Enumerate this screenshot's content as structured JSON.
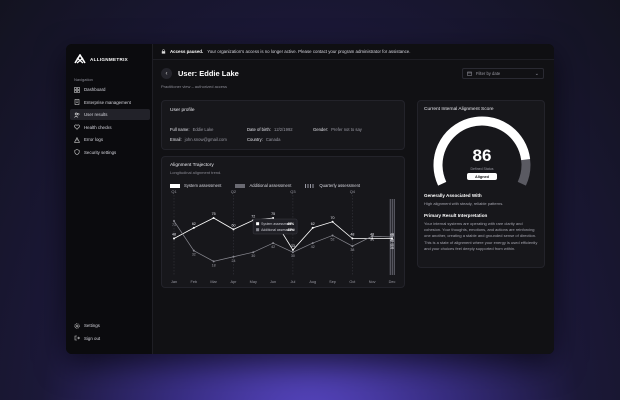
{
  "app": {
    "logo_text": "ALLIGNMETRIX"
  },
  "sidebar": {
    "heading": "Navigation",
    "items": [
      {
        "label": "Dashboard",
        "icon": "dashboard-icon"
      },
      {
        "label": "Enterprise management",
        "icon": "building-icon"
      },
      {
        "label": "User results",
        "icon": "users-icon",
        "active": true
      },
      {
        "label": "Health checks",
        "icon": "heart-icon"
      },
      {
        "label": "Error logs",
        "icon": "alert-icon"
      },
      {
        "label": "Security settings",
        "icon": "shield-icon"
      }
    ],
    "bottom": [
      {
        "label": "Settings",
        "icon": "gear-icon"
      },
      {
        "label": "Sign out",
        "icon": "logout-icon"
      }
    ]
  },
  "banner": {
    "strong": "Access paused.",
    "text": "Your organization's access is no longer active. Please contact your program administrator for assistance."
  },
  "page": {
    "title": "User: Eddie Lake",
    "subtitle": "Practitioner view – authorized access",
    "filter_placeholder": "Filter by date"
  },
  "profile": {
    "title": "User profile",
    "full_name_label": "Full name:",
    "full_name": "Eddie Lake",
    "email_label": "Email:",
    "email": "john.snow@gmail.com",
    "dob_label": "Date of birth:",
    "dob": "12/2/1992",
    "country_label": "Country:",
    "country": "Canada",
    "gender_label": "Gender:",
    "gender": "Prefer not to say"
  },
  "trajectory": {
    "title": "Alignment Trajectory",
    "subtitle": "Longitudinal alignment trend."
  },
  "chart_data": {
    "type": "line",
    "title": "Alignment Trajectory",
    "categories": [
      "Jan",
      "Feb",
      "Mar",
      "Apr",
      "May",
      "Jun",
      "Jul",
      "Aug",
      "Sep",
      "Oct",
      "Nov",
      "Dec"
    ],
    "quarters": [
      {
        "label": "Q1",
        "index": 0
      },
      {
        "label": "Q2",
        "index": 3
      },
      {
        "label": "Q3",
        "index": 6
      },
      {
        "label": "Q4",
        "index": 9
      }
    ],
    "series": [
      {
        "name": "System assessment",
        "values": [
          48,
          62,
          75,
          60,
          72,
          75,
          33,
          62,
          70,
          48,
          48,
          48
        ],
        "color": "#ffffff"
      },
      {
        "name": "Additional assessment",
        "values": [
          71,
          32,
          18,
          24,
          30,
          42,
          30,
          42,
          52,
          38,
          51,
          50
        ],
        "color": "#8a8a92"
      }
    ],
    "overlay": {
      "name": "Quarterly assessment",
      "index": 11,
      "values": [
        36,
        40,
        46,
        52
      ]
    },
    "tooltip": {
      "index": 5,
      "items": [
        {
          "label": "System assessment",
          "value": "49%"
        },
        {
          "label": "Additional assessment",
          "value": "43%"
        }
      ]
    },
    "ylim": [
      0,
      100
    ]
  },
  "score": {
    "title": "Current Internal Alignment Score",
    "value": 86,
    "status_label": "Defined Status",
    "status": "Aligned",
    "section1_title": "Generally Associated With",
    "section1_text": "High alignment with steady, reliable patterns.",
    "section2_title": "Primary Result Interpretation",
    "section2_text": "Your internal systems are operating with rare clarity and cohesion. Your thoughts, emotions, and actions are reinforcing one another, creating a stable and grounded sense of direction. This is a state of alignment where your energy is used efficiently and your choices feel deeply supported from within."
  }
}
